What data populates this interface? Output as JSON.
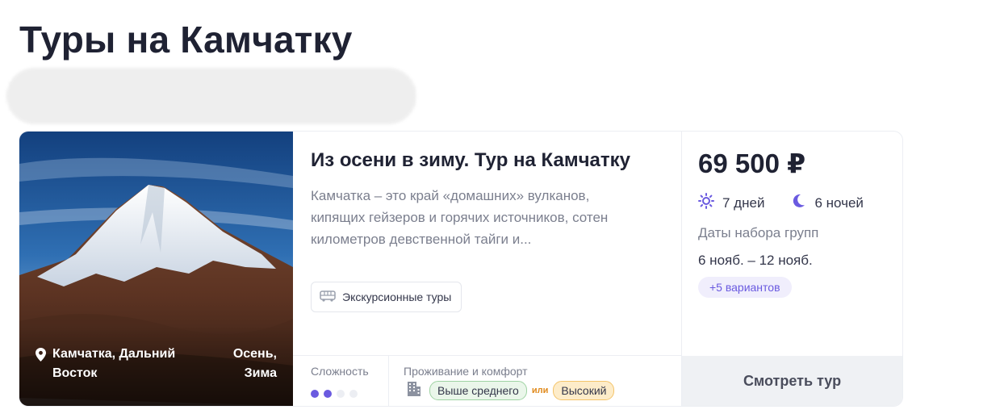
{
  "page": {
    "title": "Туры на Камчатку"
  },
  "card": {
    "location": "Камчатка, Дальний Восток",
    "season": "Осень, Зима",
    "title": "Из осени в зиму. Тур на Камчатку",
    "description": "Камчатка – это край «домашних» вулканов, кипящих гейзеров и горячих источников, сотен километров девственной тайги и...",
    "tag": "Экскурсионные туры",
    "difficulty_label": "Сложность",
    "difficulty_level": 2,
    "difficulty_max": 4,
    "comfort_label": "Проживание и комфорт",
    "comfort_option_1": "Выше среднего",
    "comfort_or": "или",
    "comfort_option_2": "Высокий",
    "price": "69 500 ₽",
    "days": "7 дней",
    "nights": "6 ночей",
    "dates_label": "Даты набора групп",
    "dates": "6 нояб. – 12 нояб.",
    "variants": "+5 вариантов",
    "button": "Смотреть тур"
  },
  "colors": {
    "accent": "#6a5ae0",
    "title_text": "#1f2233",
    "muted_text": "#7b7f8e"
  },
  "icons": {
    "location": "map-pin-icon",
    "tag": "bus-icon",
    "comfort": "building-icon",
    "days": "sun-icon",
    "nights": "moon-icon"
  }
}
